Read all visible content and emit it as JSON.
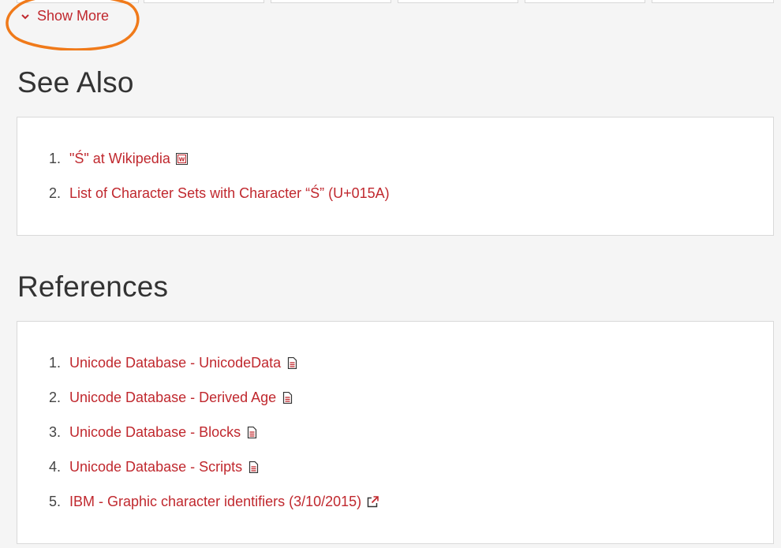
{
  "show_more": {
    "label": "Show More",
    "icon": "chevron-down-icon"
  },
  "see_also": {
    "heading": "See Also",
    "items": [
      {
        "num": "1.",
        "label": "\"Ś\" at Wikipedia",
        "icon": "wikipedia-icon"
      },
      {
        "num": "2.",
        "label": "List of Character Sets with Character “Ś” (U+015A)"
      }
    ]
  },
  "references": {
    "heading": "References",
    "items": [
      {
        "num": "1.",
        "label": "Unicode Database - UnicodeData",
        "icon": "document-icon"
      },
      {
        "num": "2.",
        "label": "Unicode Database - Derived Age",
        "icon": "document-icon"
      },
      {
        "num": "3.",
        "label": "Unicode Database - Blocks",
        "icon": "document-icon"
      },
      {
        "num": "4.",
        "label": "Unicode Database - Scripts",
        "icon": "document-icon"
      },
      {
        "num": "5.",
        "label": "IBM - Graphic character identifiers (3/10/2015)",
        "icon": "external-link-icon"
      }
    ]
  },
  "colors": {
    "link": "#c0282e",
    "annotation": "#f07a1a",
    "panel_border": "#d9d9d9",
    "background": "#f5f5f5"
  }
}
